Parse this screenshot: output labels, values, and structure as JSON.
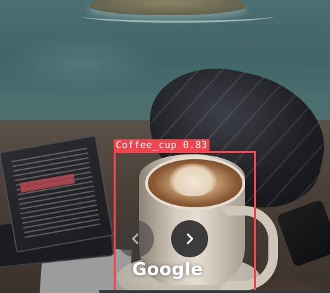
{
  "detection": {
    "label": "Coffee_cup 0.83",
    "box_color": "#f0444e"
  },
  "viewer": {
    "brand": "Google",
    "prev_icon": "chevron-left-icon",
    "next_icon": "chevron-right-icon"
  },
  "scene": {
    "book_cover_text": "We love Beirut"
  }
}
